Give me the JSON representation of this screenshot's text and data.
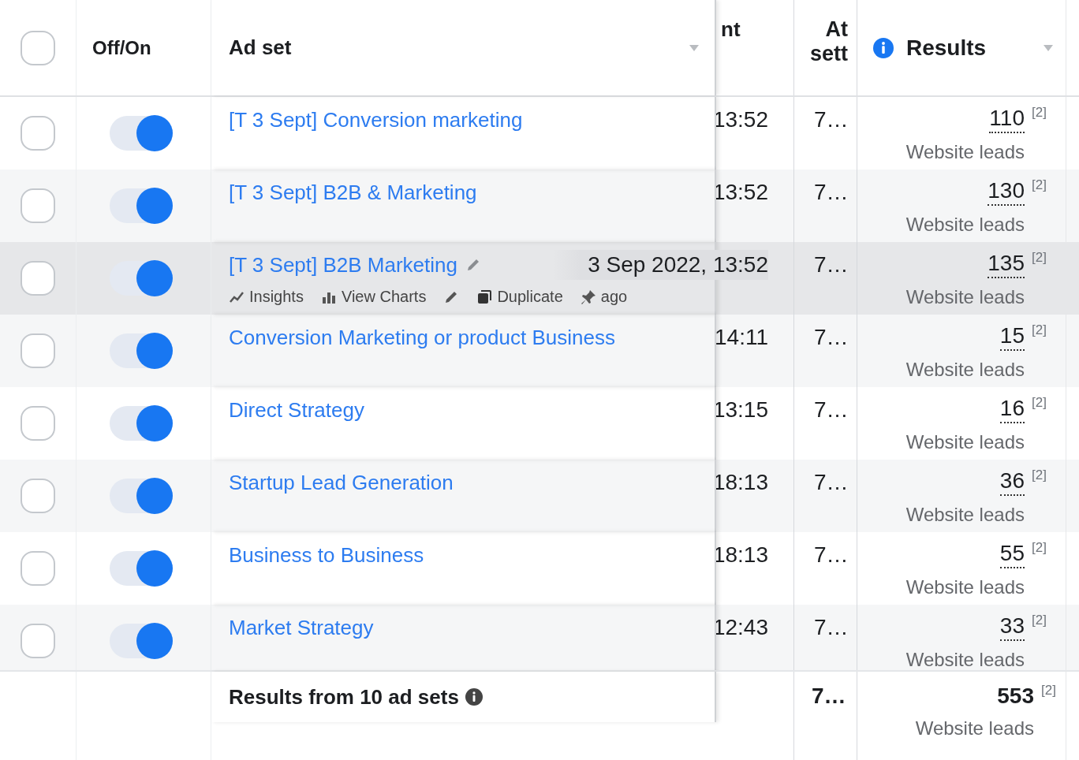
{
  "table": {
    "header": {
      "checked": false,
      "off_on": "Off/On",
      "ad_set": "Ad set",
      "column_4": "nt",
      "column_5": [
        "At",
        "sett"
      ],
      "results": "Results"
    },
    "rows": [
      {
        "checked": false,
        "on": true,
        "hovered": false,
        "ad_set": "[T 3 Sept] Conversion marketing",
        "column_4": "13:52",
        "column_5": "7…",
        "results": "110",
        "footnote": "[2]",
        "result_type": "Website leads"
      },
      {
        "checked": false,
        "on": true,
        "hovered": false,
        "ad_set": "[T 3 Sept] B2B & Marketing",
        "column_4": "13:52",
        "column_5": "7…",
        "results": "130",
        "footnote": "[2]",
        "result_type": "Website leads"
      },
      {
        "checked": false,
        "on": true,
        "hovered": true,
        "ad_set": "[T 3 Sept] B2B Marketing",
        "actions": [
          {
            "kind": "insights",
            "label": "Insights"
          },
          {
            "kind": "charts",
            "label": "View Charts"
          },
          {
            "kind": "edit"
          },
          {
            "kind": "duplicate",
            "label": "Duplicate"
          },
          {
            "kind": "pin",
            "label": "ago"
          }
        ],
        "column_4": "3 Sep 2022, 13:52",
        "column_5": "7…",
        "results": "135",
        "footnote": "[2]",
        "result_type": "Website leads"
      },
      {
        "checked": false,
        "on": true,
        "hovered": false,
        "ad_set": "Conversion Marketing or product Business",
        "column_4": "14:11",
        "column_5": "7…",
        "results": "15",
        "footnote": "[2]",
        "result_type": "Website leads"
      },
      {
        "checked": false,
        "on": true,
        "hovered": false,
        "ad_set": "Direct Strategy",
        "column_4": "13:15",
        "column_5": "7…",
        "results": "16",
        "footnote": "[2]",
        "result_type": "Website leads"
      },
      {
        "checked": false,
        "on": true,
        "hovered": false,
        "ad_set": "Startup Lead Generation",
        "column_4": "18:13",
        "column_5": "7…",
        "results": "36",
        "footnote": "[2]",
        "result_type": "Website leads"
      },
      {
        "checked": false,
        "on": true,
        "hovered": false,
        "ad_set": "Business to Business",
        "column_4": "18:13",
        "column_5": "7…",
        "results": "55",
        "footnote": "[2]",
        "result_type": "Website leads"
      },
      {
        "checked": false,
        "on": true,
        "hovered": false,
        "ad_set": "Market Strategy",
        "column_4": "12:43",
        "column_5": "7…",
        "results": "33",
        "footnote": "[2]",
        "result_type": "Website leads"
      }
    ],
    "footer": {
      "label": "Results from 10 ad sets",
      "column_5": "7…",
      "results": "553",
      "footnote": "[2]",
      "result_type": "Website leads"
    }
  }
}
